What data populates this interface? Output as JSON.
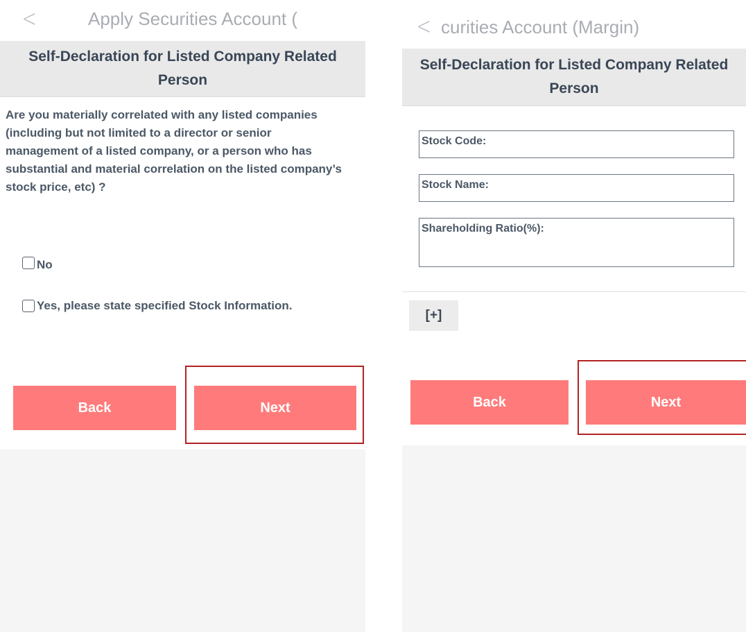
{
  "left_screen": {
    "title": "Apply Securities Account (",
    "header": "Self-Declaration for Listed Company Related Person",
    "question": "Are you materially correlated with any listed companies (including but not limited to a director or senior management of a listed company, or a person who has substantial and material correlation on the listed company’s stock price, etc) ?",
    "option_no": "No",
    "option_yes": "Yes, please state specified Stock Information.",
    "back_label": "Back",
    "next_label": "Next"
  },
  "right_screen": {
    "title": "curities Account (Margin)",
    "header": "Self-Declaration for Listed Company Related Person",
    "fields": {
      "stock_code": "Stock Code:",
      "stock_name": "Stock Name:",
      "shareholding_ratio": "Shareholding Ratio(%):"
    },
    "add_label": "[+]",
    "back_label": "Back",
    "next_label": "Next"
  },
  "icons": {
    "back": "chevron-left-icon",
    "checkbox": "checkbox-unchecked-icon"
  },
  "colors": {
    "button": "#ff7b7b",
    "highlight": "#b22222",
    "header_band": "#e9e9e9",
    "text": "#4b5866",
    "title": "#a9adb3"
  }
}
